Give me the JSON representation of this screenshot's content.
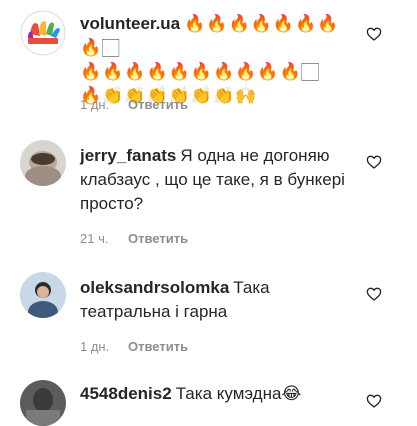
{
  "comments": [
    {
      "username": "volunteer.ua",
      "text": "",
      "emoji_lines": [
        "🔥🔥🔥🔥🔥🔥🔥🔥🏻",
        "🔥🔥🔥🔥🔥🔥🔥🔥🔥🔥🏻",
        "🔥👏👏👏👏👏👏🙌"
      ],
      "time": "1 дн.",
      "reply_label": "Ответить"
    },
    {
      "username": "jerry_fanats",
      "text": "Я одна не догоняю клабзаус , що це таке, я в бункері просто?",
      "time": "21 ч.",
      "reply_label": "Ответить"
    },
    {
      "username": "oleksandrsolomka",
      "text": "Така театральна і гарна",
      "time": "1 дн.",
      "reply_label": "Ответить"
    },
    {
      "username": "4548denis2",
      "text": "Така кумэдна😂",
      "time": "",
      "reply_label": ""
    }
  ]
}
